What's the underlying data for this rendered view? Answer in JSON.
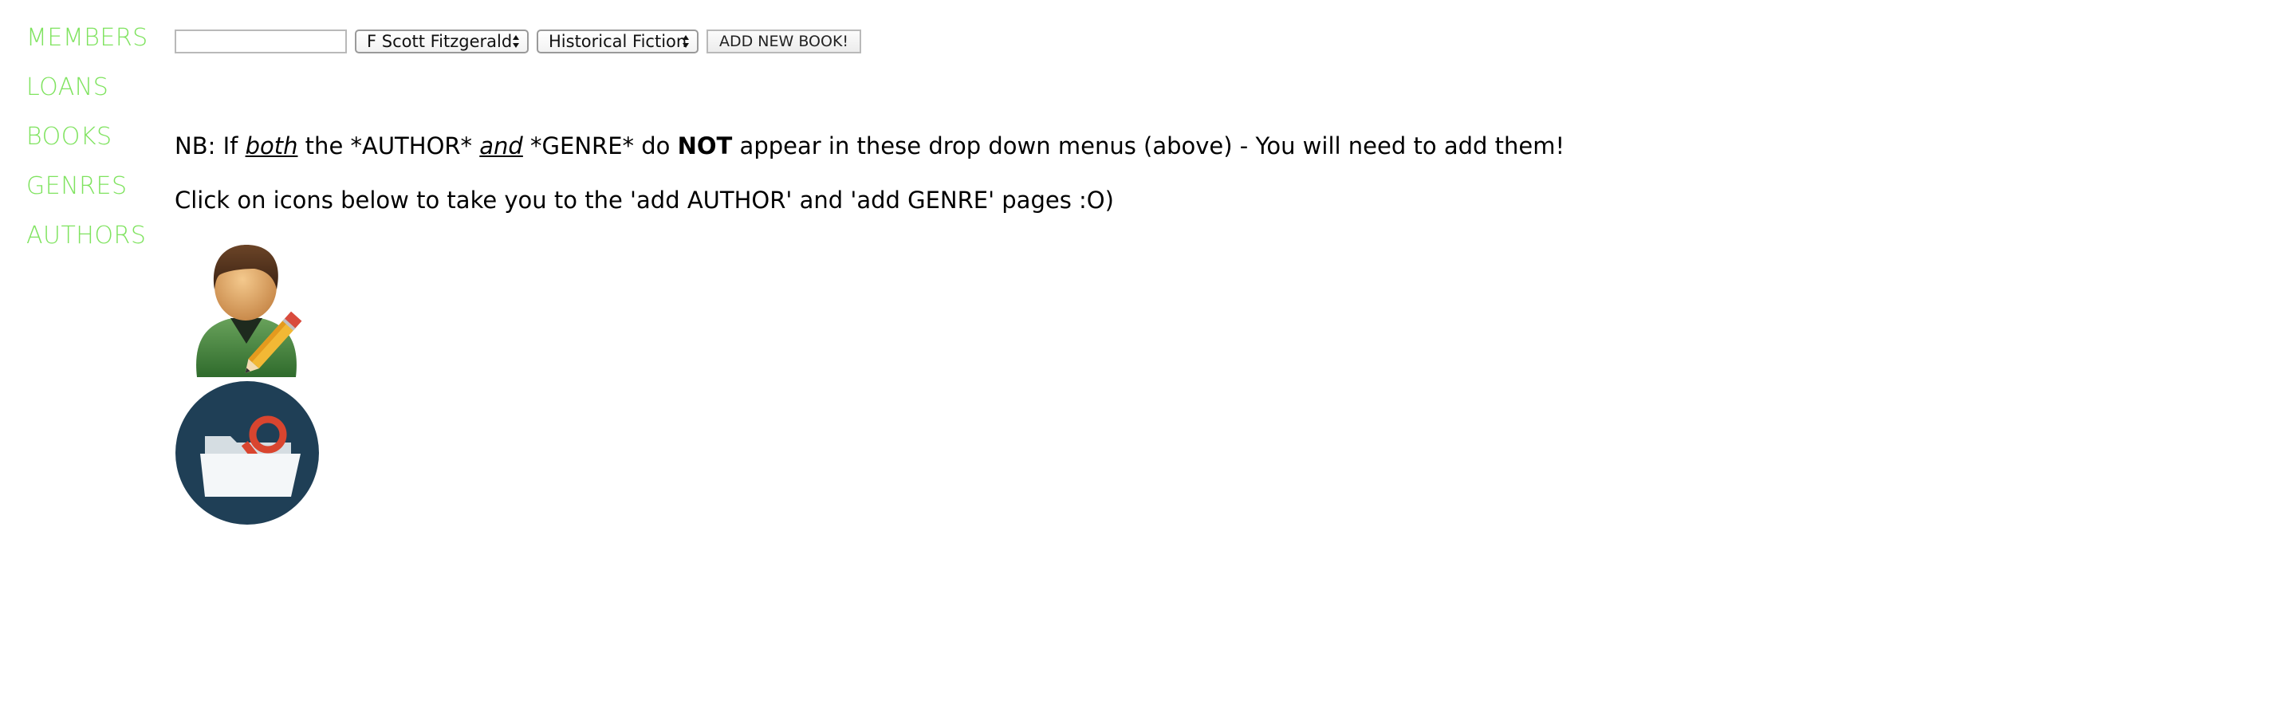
{
  "nav": {
    "items": [
      {
        "label": "MEMBERS"
      },
      {
        "label": "LOANS"
      },
      {
        "label": "BOOKS"
      },
      {
        "label": "GENRES"
      },
      {
        "label": "AUTHORS"
      }
    ],
    "color": "#7fe35f"
  },
  "form": {
    "title_input_value": "",
    "author_select": {
      "selected": "F Scott Fitzgerald"
    },
    "genre_select": {
      "selected": "Historical Fiction"
    },
    "submit_label": "ADD NEW BOOK!"
  },
  "note": {
    "prefix": "NB: If ",
    "both": "both",
    "mid1": " the *AUTHOR* ",
    "and": "and",
    "mid2": " *GENRE* do ",
    "not": "NOT",
    "suffix": " appear in these drop down menus (above) - You will need to add them!"
  },
  "instructions": "Click on icons below to take you to the 'add AUTHOR' and 'add GENRE' pages :O)",
  "icons": {
    "add_author": "add-author-icon",
    "add_genre": "add-genre-icon"
  }
}
